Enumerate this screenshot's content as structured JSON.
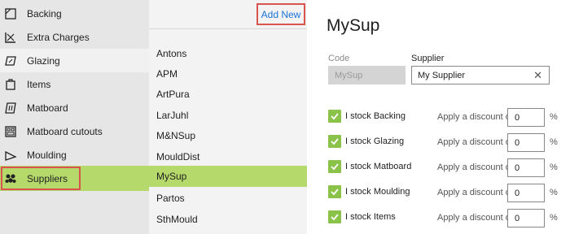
{
  "nav": {
    "items": [
      {
        "label": "Backing",
        "icon": "backing-icon"
      },
      {
        "label": "Extra Charges",
        "icon": "extra-charges-icon"
      },
      {
        "label": "Glazing",
        "icon": "glazing-icon"
      },
      {
        "label": "Items",
        "icon": "items-icon"
      },
      {
        "label": "Matboard",
        "icon": "matboard-icon"
      },
      {
        "label": "Matboard cutouts",
        "icon": "matboard-cutouts-icon"
      },
      {
        "label": "Moulding",
        "icon": "moulding-icon"
      },
      {
        "label": "Suppliers",
        "icon": "suppliers-icon"
      }
    ],
    "active": "Suppliers",
    "accent": "#b5d96a"
  },
  "list": {
    "add_new_label": "Add New",
    "items": [
      "Antons",
      "APM",
      "ArtPura",
      "LarJuhl",
      "M&NSup",
      "MouldDist",
      "MySup",
      "Partos",
      "SthMould"
    ],
    "selected": "MySup"
  },
  "detail": {
    "title": "MySup",
    "code_label": "Code",
    "code_value": "MySup",
    "supplier_label": "Supplier",
    "supplier_value": "My Supplier",
    "clear_glyph": "✕",
    "discount_label": "Apply a discount of",
    "percent_sign": "%",
    "stock_rows": [
      {
        "label": "I stock Backing",
        "checked": true,
        "discount": "0"
      },
      {
        "label": "I stock Glazing",
        "checked": true,
        "discount": "0"
      },
      {
        "label": "I stock Matboard",
        "checked": true,
        "discount": "0"
      },
      {
        "label": "I stock Moulding",
        "checked": true,
        "discount": "0"
      },
      {
        "label": "I stock Items",
        "checked": true,
        "discount": "0"
      }
    ]
  },
  "colors": {
    "selection": "#b5d96a",
    "checkbox": "#8bc34a",
    "link": "#1a73d9",
    "highlight_border": "#d9534f"
  }
}
